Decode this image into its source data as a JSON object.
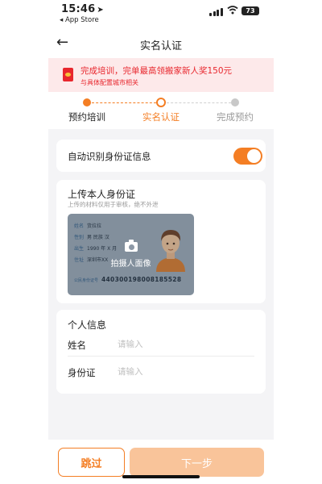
{
  "status_bar": {
    "time": "15:46",
    "location_glyph": "➤",
    "back_app": "◂ App Store",
    "battery": "73"
  },
  "nav": {
    "back_glyph": "←",
    "title": "实名认证"
  },
  "banner": {
    "main": "完成培训，完单最高领搬家新人奖150元",
    "sub": "与具体配置城市相关",
    "colors": {
      "background": "#fde9ea",
      "text": "#e8262d"
    }
  },
  "steps": [
    {
      "label": "预约培训",
      "state": "done"
    },
    {
      "label": "实名认证",
      "state": "current"
    },
    {
      "label": "完成预约",
      "state": "pending"
    }
  ],
  "auto_recognize": {
    "label": "自动识别身份证信息",
    "enabled": true
  },
  "upload": {
    "title": "上传本人身份证",
    "subtitle": "上传的材料仅用于审核，绝不外泄",
    "card_rows": [
      {
        "k": "姓名",
        "v": "货拉拉"
      },
      {
        "k": "性别",
        "v": "男   民族 汉"
      },
      {
        "k": "出生",
        "v": "1990 年 X 月"
      },
      {
        "k": "住址",
        "v": "深圳市XX"
      }
    ],
    "id_label": "公民身份证号",
    "id_number": "440300198008185528",
    "capture_label": "拍摄人面像"
  },
  "personal_info": {
    "title": "个人信息",
    "fields": [
      {
        "label": "姓名",
        "placeholder": "请输入",
        "value": ""
      },
      {
        "label": "身份证",
        "placeholder": "请输入",
        "value": ""
      }
    ]
  },
  "actions": {
    "skip": "跳过",
    "next": "下一步"
  },
  "theme": {
    "accent": "#f47e24",
    "next_disabled": "#f9c49a",
    "page_bg": "#f4f4f6"
  }
}
